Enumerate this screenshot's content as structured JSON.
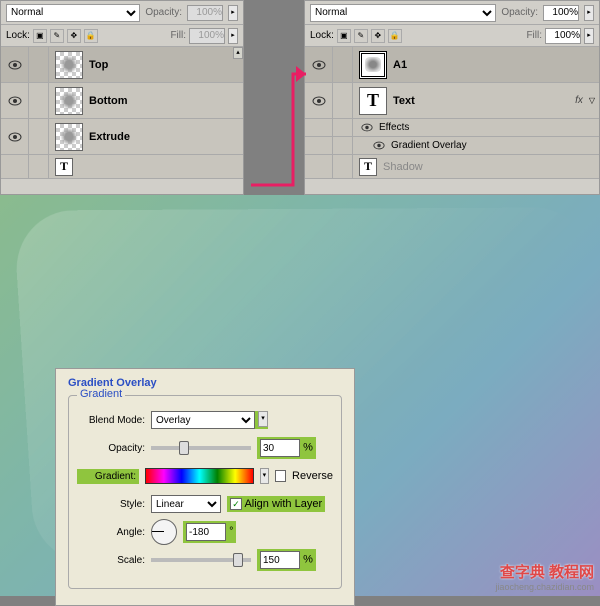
{
  "panels": {
    "left": {
      "blend_mode": "Normal",
      "opacity_label": "Opacity:",
      "opacity_value": "100%",
      "lock_label": "Lock:",
      "fill_label": "Fill:",
      "fill_value": "100%",
      "layers": [
        {
          "name": "Top"
        },
        {
          "name": "Bottom"
        },
        {
          "name": "Extrude"
        }
      ]
    },
    "right": {
      "blend_mode": "Normal",
      "opacity_label": "Opacity:",
      "opacity_value": "100%",
      "lock_label": "Lock:",
      "fill_label": "Fill:",
      "fill_value": "100%",
      "layers": [
        {
          "name": "A1"
        },
        {
          "name": "Text",
          "type": "text",
          "fx": "fx"
        }
      ],
      "effects_label": "Effects",
      "gradient_overlay_label": "Gradient Overlay",
      "shadow_label": "Shadow"
    }
  },
  "dialog": {
    "title": "Gradient Overlay",
    "fieldset_title": "Gradient",
    "blend_mode_label": "Blend Mode:",
    "blend_mode_value": "Overlay",
    "opacity_label": "Opacity:",
    "opacity_value": "30",
    "percent": "%",
    "gradient_label": "Gradient:",
    "reverse_label": "Reverse",
    "style_label": "Style:",
    "style_value": "Linear",
    "align_label": "Align with Layer",
    "angle_label": "Angle:",
    "angle_value": "-180",
    "degree": "°",
    "scale_label": "Scale:",
    "scale_value": "150"
  },
  "watermark": {
    "main": "查字典 教程网",
    "sub": "jiaocheng.chazidian.com"
  }
}
